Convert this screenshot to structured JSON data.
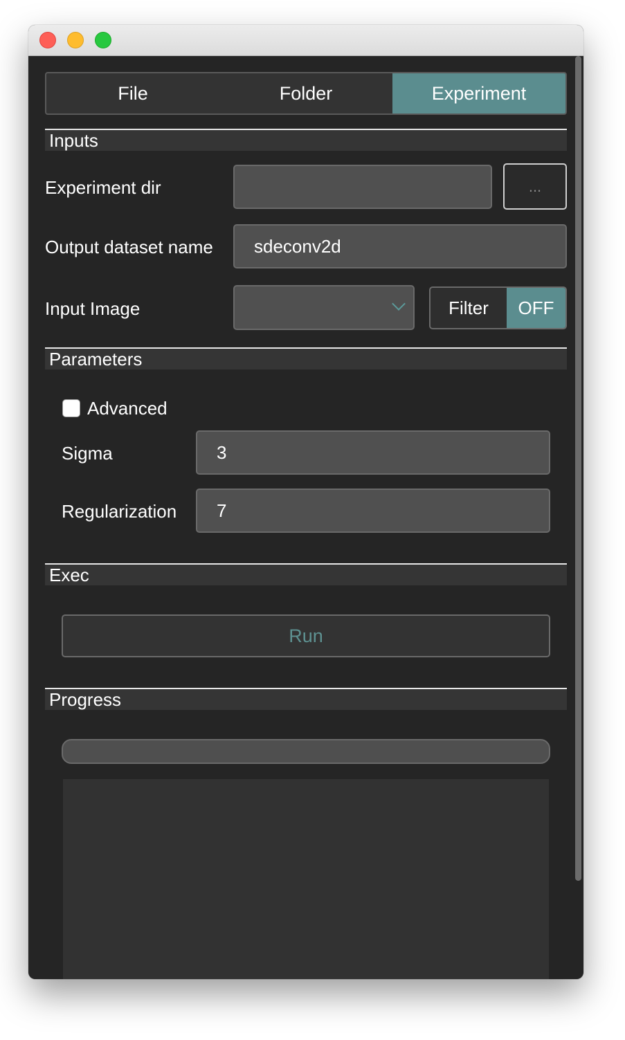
{
  "tabs": [
    {
      "label": "File",
      "active": false
    },
    {
      "label": "Folder",
      "active": false
    },
    {
      "label": "Experiment",
      "active": true
    }
  ],
  "sections": {
    "inputs": "Inputs",
    "parameters": "Parameters",
    "exec": "Exec",
    "progress": "Progress"
  },
  "inputs": {
    "experiment_dir_label": "Experiment dir",
    "experiment_dir_value": "",
    "browse_label": "...",
    "output_name_label": "Output dataset name",
    "output_name_value": "sdeconv2d",
    "input_image_label": "Input Image",
    "input_image_value": "",
    "filter_label": "Filter",
    "filter_state": "OFF"
  },
  "parameters": {
    "advanced_label": "Advanced",
    "advanced_checked": false,
    "sigma_label": "Sigma",
    "sigma_value": "3",
    "regularization_label": "Regularization",
    "regularization_value": "7"
  },
  "exec": {
    "run_label": "Run"
  },
  "progress": {
    "value_percent": 0
  },
  "colors": {
    "accent": "#5b8d8f",
    "background": "#252525",
    "field": "#505050"
  }
}
